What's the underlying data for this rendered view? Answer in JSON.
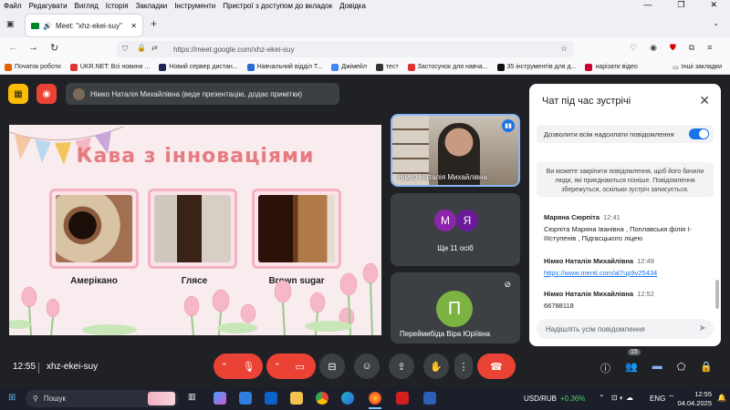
{
  "menubar": {
    "items": [
      "Файл",
      "Редагувати",
      "Вигляд",
      "Історія",
      "Закладки",
      "Інструменти",
      "Пристрої з доступом до вкладок",
      "Довідка"
    ]
  },
  "browser": {
    "tab_title": "Meet: \"xhz-ekei-suy\"",
    "url": "https://meet.google.com/xhz-ekei-suy"
  },
  "bookmarks": [
    {
      "label": "Початок роботи",
      "color": "#e66000"
    },
    {
      "label": "UKR.NET: Всі новини ...",
      "color": "#d33"
    },
    {
      "label": "Новий сервер дистан...",
      "color": "#225"
    },
    {
      "label": "Навчальний відділ Т...",
      "color": "#2a6ad8"
    },
    {
      "label": "Джімейл",
      "color": "#4285f4"
    },
    {
      "label": "тест",
      "color": "#333"
    },
    {
      "label": "Застосунок для навча...",
      "color": "#d33"
    },
    {
      "label": "35 інструментів для д...",
      "color": "#111"
    },
    {
      "label": "нарізати відео",
      "color": "#c03"
    }
  ],
  "bookmarks_other": "Інші закладки",
  "presenter_bar": "Німко Наталія Михайлівна (веде презентацію, додає примітки)",
  "slide": {
    "title": "Кава з інноваціями",
    "captions": [
      "Амерікано",
      "Глясе",
      "Brown sugar"
    ]
  },
  "tiles": {
    "speaker_name": "Німко Наталія Михайлівна",
    "avatars": [
      "М",
      "Я"
    ],
    "others_label": "Ще 11 осіб",
    "participant_initial": "П",
    "participant_name": "Переймибіда Віра Юріївна"
  },
  "chat": {
    "title": "Чат під час зустрічі",
    "toggle_label": "Дозволити всім надсилати повідомлення",
    "note": "Ви можете закріпити повідомлення, щоб його бачили люди, які приєднаються пізніше. Повідомлення збережуться, оскільки зустріч записується.",
    "messages": [
      {
        "name": "Маряна Сюрпіта",
        "time": "12:41",
        "text": "Сюрпіта Маряна Іванівна , Поплавськя філія І-ІІІступенів , Підгасцького ліцею"
      },
      {
        "name": "Німко Наталія Михайлівна",
        "time": "12:49",
        "text": "https://www.menti.com/al7up9v25434"
      },
      {
        "name": "Німко Наталія Михайлівна",
        "time": "12:52",
        "text": "66788118"
      }
    ],
    "input_placeholder": "Надішліть усім повідомлення"
  },
  "bottom": {
    "time": "12:55",
    "code": "xhz-ekei-suy",
    "participants_badge": "15"
  },
  "taskbar": {
    "search_placeholder": "Пошук",
    "ticker": "USD/RUB",
    "change": "+0.36%",
    "lang": "ENG",
    "clock": "12:55",
    "date": "04.04.2025"
  },
  "colors": {
    "accent": "#1a73e8",
    "end_call": "#ea4335",
    "muted_btn": "#ea4335"
  }
}
